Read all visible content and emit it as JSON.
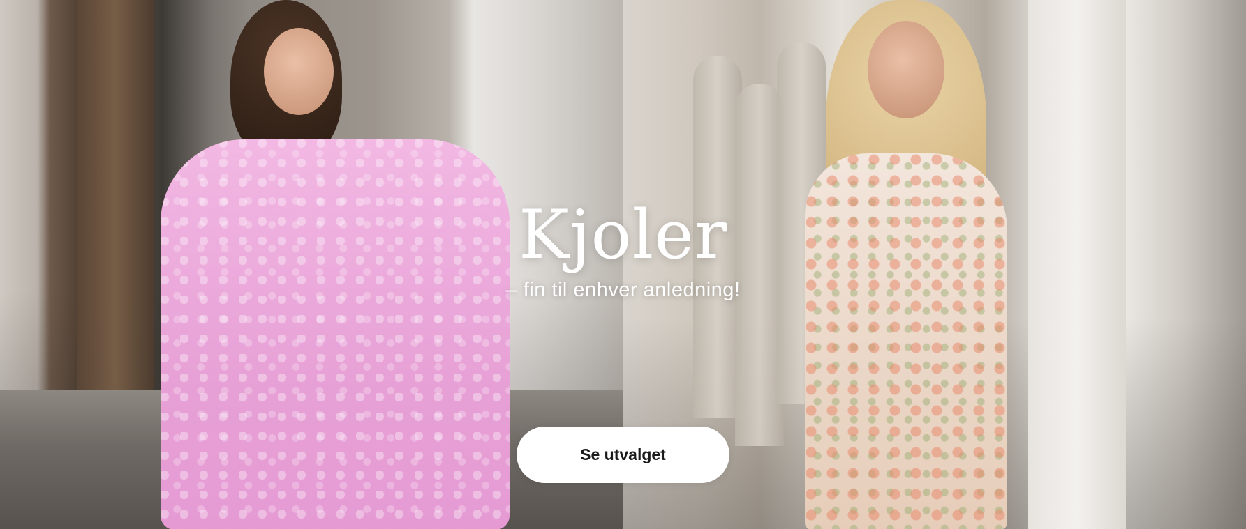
{
  "banner": {
    "title": "Kjoler",
    "subtitle": "– fin til enhver anledning!",
    "cta_label": "Se utvalget"
  }
}
